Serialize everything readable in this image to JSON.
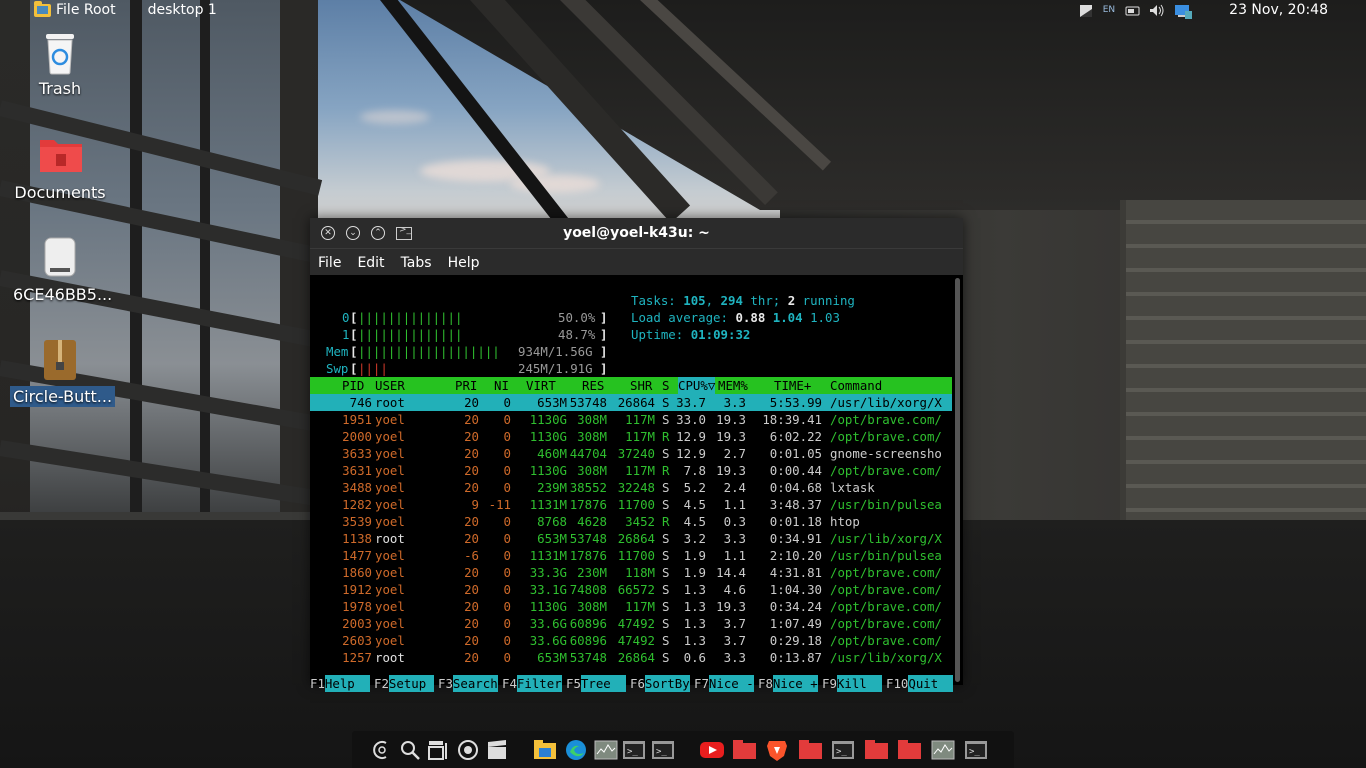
{
  "top_panel": {
    "file_root": "File Root",
    "desktop": "desktop 1",
    "lang": "EN",
    "clock": "23 Nov, 20:48"
  },
  "desktop_icons": [
    {
      "label": "Trash",
      "icon": "trash-icon"
    },
    {
      "label": "Documents",
      "icon": "folder-icon"
    },
    {
      "label": "6CE46BB5...",
      "icon": "drive-icon"
    },
    {
      "label": "Circle-Butt...",
      "icon": "archive-icon"
    }
  ],
  "terminal": {
    "title": "yoel@yoel-k43u: ~",
    "menu": [
      "File",
      "Edit",
      "Tabs",
      "Help"
    ],
    "meters": {
      "cpu0": {
        "label": "0",
        "bars": "||||||||||||||",
        "value": "50.0%"
      },
      "cpu1": {
        "label": "1",
        "bars": "||||||||||||||",
        "value": "48.7%"
      },
      "mem": {
        "label": "Mem",
        "bars": "|||||||||||||||||||",
        "value": "934M/1.56G"
      },
      "swp": {
        "label": "Swp",
        "bars": "||||",
        "value": "245M/1.91G"
      }
    },
    "stats": {
      "tasks_label": "Tasks:",
      "tasks": "105",
      "threads": "294",
      "thr_label": "thr;",
      "running": "2",
      "running_label": "running",
      "load_label": "Load average:",
      "load1": "0.88",
      "load5": "1.04",
      "load15": "1.03",
      "uptime_label": "Uptime:",
      "uptime": "01:09:32"
    },
    "columns": [
      "PID",
      "USER",
      "PRI",
      "NI",
      "VIRT",
      "RES",
      "SHR",
      "S",
      "CPU%▽",
      "MEM%",
      "TIME+",
      "Command"
    ],
    "processes": [
      {
        "pid": "746",
        "user": "root",
        "pri": "20",
        "ni": "0",
        "virt": "653M",
        "res": "53748",
        "shr": "26864",
        "s": "S",
        "cpu": "33.7",
        "mem": "3.3",
        "time": "5:53.99",
        "cmd": "/usr/lib/xorg/X"
      },
      {
        "pid": "1951",
        "user": "yoel",
        "pri": "20",
        "ni": "0",
        "virt": "1130G",
        "res": "308M",
        "shr": "117M",
        "s": "S",
        "cpu": "33.0",
        "mem": "19.3",
        "time": "18:39.41",
        "cmd": "/opt/brave.com/"
      },
      {
        "pid": "2000",
        "user": "yoel",
        "pri": "20",
        "ni": "0",
        "virt": "1130G",
        "res": "308M",
        "shr": "117M",
        "s": "R",
        "cpu": "12.9",
        "mem": "19.3",
        "time": "6:02.22",
        "cmd": "/opt/brave.com/"
      },
      {
        "pid": "3633",
        "user": "yoel",
        "pri": "20",
        "ni": "0",
        "virt": "460M",
        "res": "44704",
        "shr": "37240",
        "s": "S",
        "cpu": "12.9",
        "mem": "2.7",
        "time": "0:01.05",
        "cmd": "gnome-screensho"
      },
      {
        "pid": "3631",
        "user": "yoel",
        "pri": "20",
        "ni": "0",
        "virt": "1130G",
        "res": "308M",
        "shr": "117M",
        "s": "R",
        "cpu": "7.8",
        "mem": "19.3",
        "time": "0:00.44",
        "cmd": "/opt/brave.com/"
      },
      {
        "pid": "3488",
        "user": "yoel",
        "pri": "20",
        "ni": "0",
        "virt": "239M",
        "res": "38552",
        "shr": "32248",
        "s": "S",
        "cpu": "5.2",
        "mem": "2.4",
        "time": "0:04.68",
        "cmd": "lxtask"
      },
      {
        "pid": "1282",
        "user": "yoel",
        "pri": "9",
        "ni": "-11",
        "virt": "1131M",
        "res": "17876",
        "shr": "11700",
        "s": "S",
        "cpu": "4.5",
        "mem": "1.1",
        "time": "3:48.37",
        "cmd": "/usr/bin/pulsea"
      },
      {
        "pid": "3539",
        "user": "yoel",
        "pri": "20",
        "ni": "0",
        "virt": "8768",
        "res": "4628",
        "shr": "3452",
        "s": "R",
        "cpu": "4.5",
        "mem": "0.3",
        "time": "0:01.18",
        "cmd": "htop"
      },
      {
        "pid": "1138",
        "user": "root",
        "pri": "20",
        "ni": "0",
        "virt": "653M",
        "res": "53748",
        "shr": "26864",
        "s": "S",
        "cpu": "3.2",
        "mem": "3.3",
        "time": "0:34.91",
        "cmd": "/usr/lib/xorg/X"
      },
      {
        "pid": "1477",
        "user": "yoel",
        "pri": "-6",
        "ni": "0",
        "virt": "1131M",
        "res": "17876",
        "shr": "11700",
        "s": "S",
        "cpu": "1.9",
        "mem": "1.1",
        "time": "2:10.20",
        "cmd": "/usr/bin/pulsea"
      },
      {
        "pid": "1860",
        "user": "yoel",
        "pri": "20",
        "ni": "0",
        "virt": "33.3G",
        "res": "230M",
        "shr": "118M",
        "s": "S",
        "cpu": "1.9",
        "mem": "14.4",
        "time": "4:31.81",
        "cmd": "/opt/brave.com/"
      },
      {
        "pid": "1912",
        "user": "yoel",
        "pri": "20",
        "ni": "0",
        "virt": "33.1G",
        "res": "74808",
        "shr": "66572",
        "s": "S",
        "cpu": "1.3",
        "mem": "4.6",
        "time": "1:04.30",
        "cmd": "/opt/brave.com/"
      },
      {
        "pid": "1978",
        "user": "yoel",
        "pri": "20",
        "ni": "0",
        "virt": "1130G",
        "res": "308M",
        "shr": "117M",
        "s": "S",
        "cpu": "1.3",
        "mem": "19.3",
        "time": "0:34.24",
        "cmd": "/opt/brave.com/"
      },
      {
        "pid": "2003",
        "user": "yoel",
        "pri": "20",
        "ni": "0",
        "virt": "33.6G",
        "res": "60896",
        "shr": "47492",
        "s": "S",
        "cpu": "1.3",
        "mem": "3.7",
        "time": "1:07.49",
        "cmd": "/opt/brave.com/"
      },
      {
        "pid": "2603",
        "user": "yoel",
        "pri": "20",
        "ni": "0",
        "virt": "33.6G",
        "res": "60896",
        "shr": "47492",
        "s": "S",
        "cpu": "1.3",
        "mem": "3.7",
        "time": "0:29.18",
        "cmd": "/opt/brave.com/"
      },
      {
        "pid": "1257",
        "user": "root",
        "pri": "20",
        "ni": "0",
        "virt": "653M",
        "res": "53748",
        "shr": "26864",
        "s": "S",
        "cpu": "0.6",
        "mem": "3.3",
        "time": "0:13.87",
        "cmd": "/usr/lib/xorg/X"
      }
    ],
    "fkeys": [
      {
        "key": "F1",
        "label": "Help  "
      },
      {
        "key": "F2",
        "label": "Setup "
      },
      {
        "key": "F3",
        "label": "Search"
      },
      {
        "key": "F4",
        "label": "Filter"
      },
      {
        "key": "F5",
        "label": "Tree  "
      },
      {
        "key": "F6",
        "label": "SortBy"
      },
      {
        "key": "F7",
        "label": "Nice -"
      },
      {
        "key": "F8",
        "label": "Nice +"
      },
      {
        "key": "F9",
        "label": "Kill  "
      },
      {
        "key": "F10",
        "label": "Quit  "
      }
    ]
  },
  "dock": [
    "debian-icon",
    "search-icon",
    "window-switcher-icon",
    "screenshot-icon",
    "clapper-icon",
    "file-manager-icon",
    "edge-icon",
    "system-monitor-icon",
    "terminal-icon",
    "terminal-icon",
    "youtube-icon",
    "folder-icon",
    "brave-icon",
    "folder-icon",
    "terminal-icon",
    "folder-icon",
    "folder-icon",
    "system-monitor-icon",
    "terminal-icon"
  ],
  "colors": {
    "htop_green": "#26c220",
    "htop_cyan": "#22b0b8",
    "htop_red": "#cf3a2a"
  }
}
